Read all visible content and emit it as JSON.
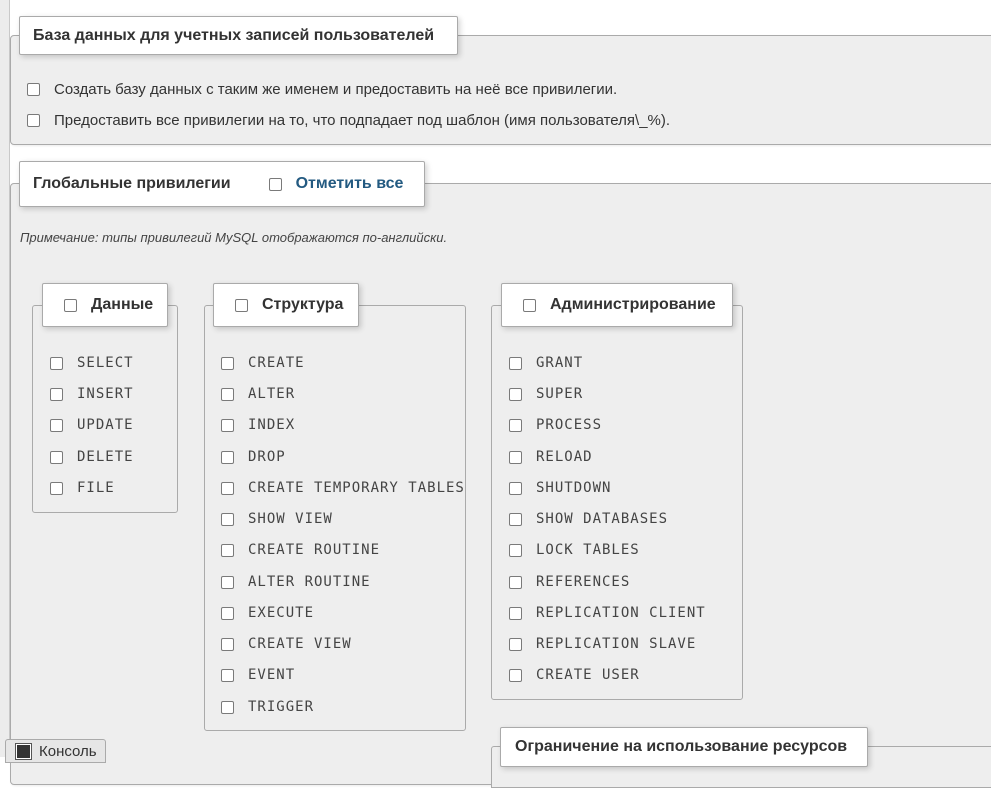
{
  "db_section": {
    "legend": "База данных для учетных записей пользователей",
    "options": [
      "Создать базу данных с таким же именем и предоставить на неё все привилегии.",
      "Предоставить все привилегии на то, что подпадает под шаблон (имя пользователя\\_%)."
    ]
  },
  "global_privileges": {
    "legend": "Глобальные привилегии",
    "check_all": "Отметить все",
    "note": "Примечание: типы привилегий MySQL отображаются по-английски.",
    "groups": {
      "data": {
        "title": "Данные",
        "items": [
          "SELECT",
          "INSERT",
          "UPDATE",
          "DELETE",
          "FILE"
        ]
      },
      "structure": {
        "title": "Структура",
        "items": [
          "CREATE",
          "ALTER",
          "INDEX",
          "DROP",
          "CREATE TEMPORARY TABLES",
          "SHOW VIEW",
          "CREATE ROUTINE",
          "ALTER ROUTINE",
          "EXECUTE",
          "CREATE VIEW",
          "EVENT",
          "TRIGGER"
        ]
      },
      "administration": {
        "title": "Администрирование",
        "items": [
          "GRANT",
          "SUPER",
          "PROCESS",
          "RELOAD",
          "SHUTDOWN",
          "SHOW DATABASES",
          "LOCK TABLES",
          "REFERENCES",
          "REPLICATION CLIENT",
          "REPLICATION SLAVE",
          "CREATE USER"
        ]
      }
    },
    "resource_limits": {
      "legend": "Ограничение на использование ресурсов"
    }
  },
  "console": {
    "label": "Консоль"
  }
}
